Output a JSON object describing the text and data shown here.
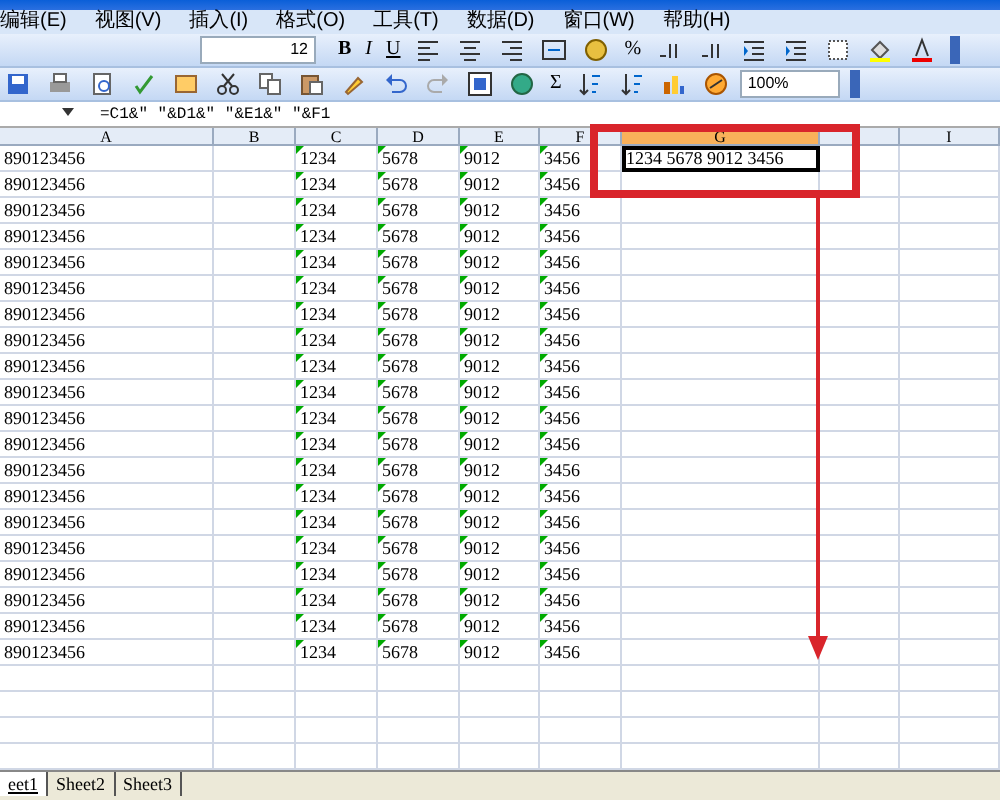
{
  "menu_bar": {
    "items": [
      "编辑(E)",
      "视图(V)",
      "插入(I)",
      "格式(O)",
      "工具(T)",
      "数据(D)",
      "窗口(W)",
      "帮助(H)"
    ]
  },
  "formatting_toolbar": {
    "font_size": "12",
    "buttons": [
      {
        "kind": "text",
        "label": "B"
      },
      {
        "kind": "text",
        "label": "I"
      },
      {
        "kind": "text",
        "label": "U"
      },
      {
        "kind": "icon"
      },
      {
        "kind": "icon"
      },
      {
        "kind": "icon"
      },
      {
        "kind": "icon"
      },
      {
        "kind": "icon"
      },
      {
        "kind": "text",
        "label": "%"
      },
      {
        "kind": "icon"
      },
      {
        "kind": "icon"
      },
      {
        "kind": "icon"
      },
      {
        "kind": "icon"
      },
      {
        "kind": "icon"
      },
      {
        "kind": "icon"
      },
      {
        "kind": "icon"
      }
    ]
  },
  "standard_toolbar": {
    "zoom": "100%",
    "buttons": [
      {
        "kind": "icon"
      },
      {
        "kind": "icon"
      },
      {
        "kind": "icon"
      },
      {
        "kind": "icon"
      },
      {
        "kind": "icon"
      },
      {
        "kind": "icon"
      },
      {
        "kind": "icon"
      },
      {
        "kind": "icon"
      },
      {
        "kind": "icon"
      },
      {
        "kind": "icon"
      },
      {
        "kind": "icon"
      },
      {
        "kind": "icon"
      },
      {
        "kind": "icon"
      },
      {
        "kind": "text",
        "label": "Σ"
      },
      {
        "kind": "icon"
      },
      {
        "kind": "icon"
      },
      {
        "kind": "icon"
      },
      {
        "kind": "icon"
      }
    ]
  },
  "formula_bar": {
    "formula": "=C1&\" \"&D1&\" \"&E1&\" \"&F1"
  },
  "columns": [
    {
      "label": "A",
      "flagged": false,
      "selected": false
    },
    {
      "label": "B",
      "flagged": false,
      "selected": false
    },
    {
      "label": "C",
      "flagged": true,
      "selected": false
    },
    {
      "label": "D",
      "flagged": true,
      "selected": false
    },
    {
      "label": "E",
      "flagged": true,
      "selected": false
    },
    {
      "label": "F",
      "flagged": true,
      "selected": false
    },
    {
      "label": "G",
      "flagged": false,
      "selected": true
    },
    {
      "flagged": false,
      "selected": false
    },
    {
      "label": "I",
      "flagged": false,
      "selected": false
    }
  ],
  "rows": [
    {
      "selected": true,
      "cells": [
        "890123456",
        null,
        "1234",
        "5678",
        "9012",
        "3456",
        "1234 5678 9012 3456"
      ]
    },
    {
      "selected": false,
      "cells": [
        "890123456",
        null,
        "1234",
        "5678",
        "9012",
        "3456"
      ]
    },
    {
      "selected": false,
      "cells": [
        "890123456",
        null,
        "1234",
        "5678",
        "9012",
        "3456"
      ]
    },
    {
      "selected": false,
      "cells": [
        "890123456",
        null,
        "1234",
        "5678",
        "9012",
        "3456"
      ]
    },
    {
      "selected": false,
      "cells": [
        "890123456",
        null,
        "1234",
        "5678",
        "9012",
        "3456"
      ]
    },
    {
      "selected": false,
      "cells": [
        "890123456",
        null,
        "1234",
        "5678",
        "9012",
        "3456"
      ]
    },
    {
      "selected": false,
      "cells": [
        "890123456",
        null,
        "1234",
        "5678",
        "9012",
        "3456"
      ]
    },
    {
      "selected": false,
      "cells": [
        "890123456",
        null,
        "1234",
        "5678",
        "9012",
        "3456"
      ]
    },
    {
      "selected": false,
      "cells": [
        "890123456",
        null,
        "1234",
        "5678",
        "9012",
        "3456"
      ]
    },
    {
      "selected": false,
      "cells": [
        "890123456",
        null,
        "1234",
        "5678",
        "9012",
        "3456"
      ]
    },
    {
      "selected": false,
      "cells": [
        "890123456",
        null,
        "1234",
        "5678",
        "9012",
        "3456"
      ]
    },
    {
      "selected": false,
      "cells": [
        "890123456",
        null,
        "1234",
        "5678",
        "9012",
        "3456"
      ]
    },
    {
      "selected": false,
      "cells": [
        "890123456",
        null,
        "1234",
        "5678",
        "9012",
        "3456"
      ]
    },
    {
      "selected": false,
      "cells": [
        "890123456",
        null,
        "1234",
        "5678",
        "9012",
        "3456"
      ]
    },
    {
      "selected": false,
      "cells": [
        "890123456",
        null,
        "1234",
        "5678",
        "9012",
        "3456"
      ]
    },
    {
      "selected": false,
      "cells": [
        "890123456",
        null,
        "1234",
        "5678",
        "9012",
        "3456"
      ]
    },
    {
      "selected": false,
      "cells": [
        "890123456",
        null,
        "1234",
        "5678",
        "9012",
        "3456"
      ]
    },
    {
      "selected": false,
      "cells": [
        "890123456",
        null,
        "1234",
        "5678",
        "9012",
        "3456"
      ]
    },
    {
      "selected": false,
      "cells": [
        "890123456",
        null,
        "1234",
        "5678",
        "9012",
        "3456"
      ]
    },
    {
      "selected": false,
      "cells": [
        "890123456",
        null,
        "1234",
        "5678",
        "9012",
        "3456"
      ]
    }
  ],
  "sheet_tabs": [
    {
      "label": "eet1",
      "selected": true
    },
    {
      "label": "Sheet2",
      "selected": false
    },
    {
      "label": "Sheet3",
      "selected": false
    }
  ]
}
